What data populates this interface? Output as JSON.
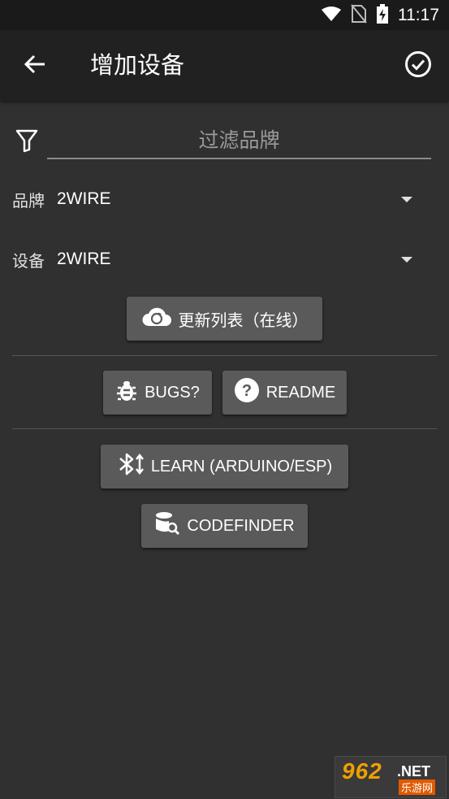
{
  "status_bar": {
    "time": "11:17"
  },
  "app_bar": {
    "title": "增加设备"
  },
  "filter": {
    "placeholder": "过滤品牌"
  },
  "brand": {
    "label": "品牌",
    "value": "2WIRE"
  },
  "device": {
    "label": "设备",
    "value": "2WIRE"
  },
  "buttons": {
    "update_list": "更新列表（在线）",
    "bugs": "BUGS?",
    "readme": "README",
    "learn": "LEARN (ARDUINO/ESP)",
    "codefinder": "CODEFINDER"
  },
  "watermark": {
    "number": "962",
    "net": ".NET",
    "site": "乐游网"
  },
  "colors": {
    "background": "#303030",
    "app_bar": "#212121",
    "button": "#5a5a5a"
  }
}
